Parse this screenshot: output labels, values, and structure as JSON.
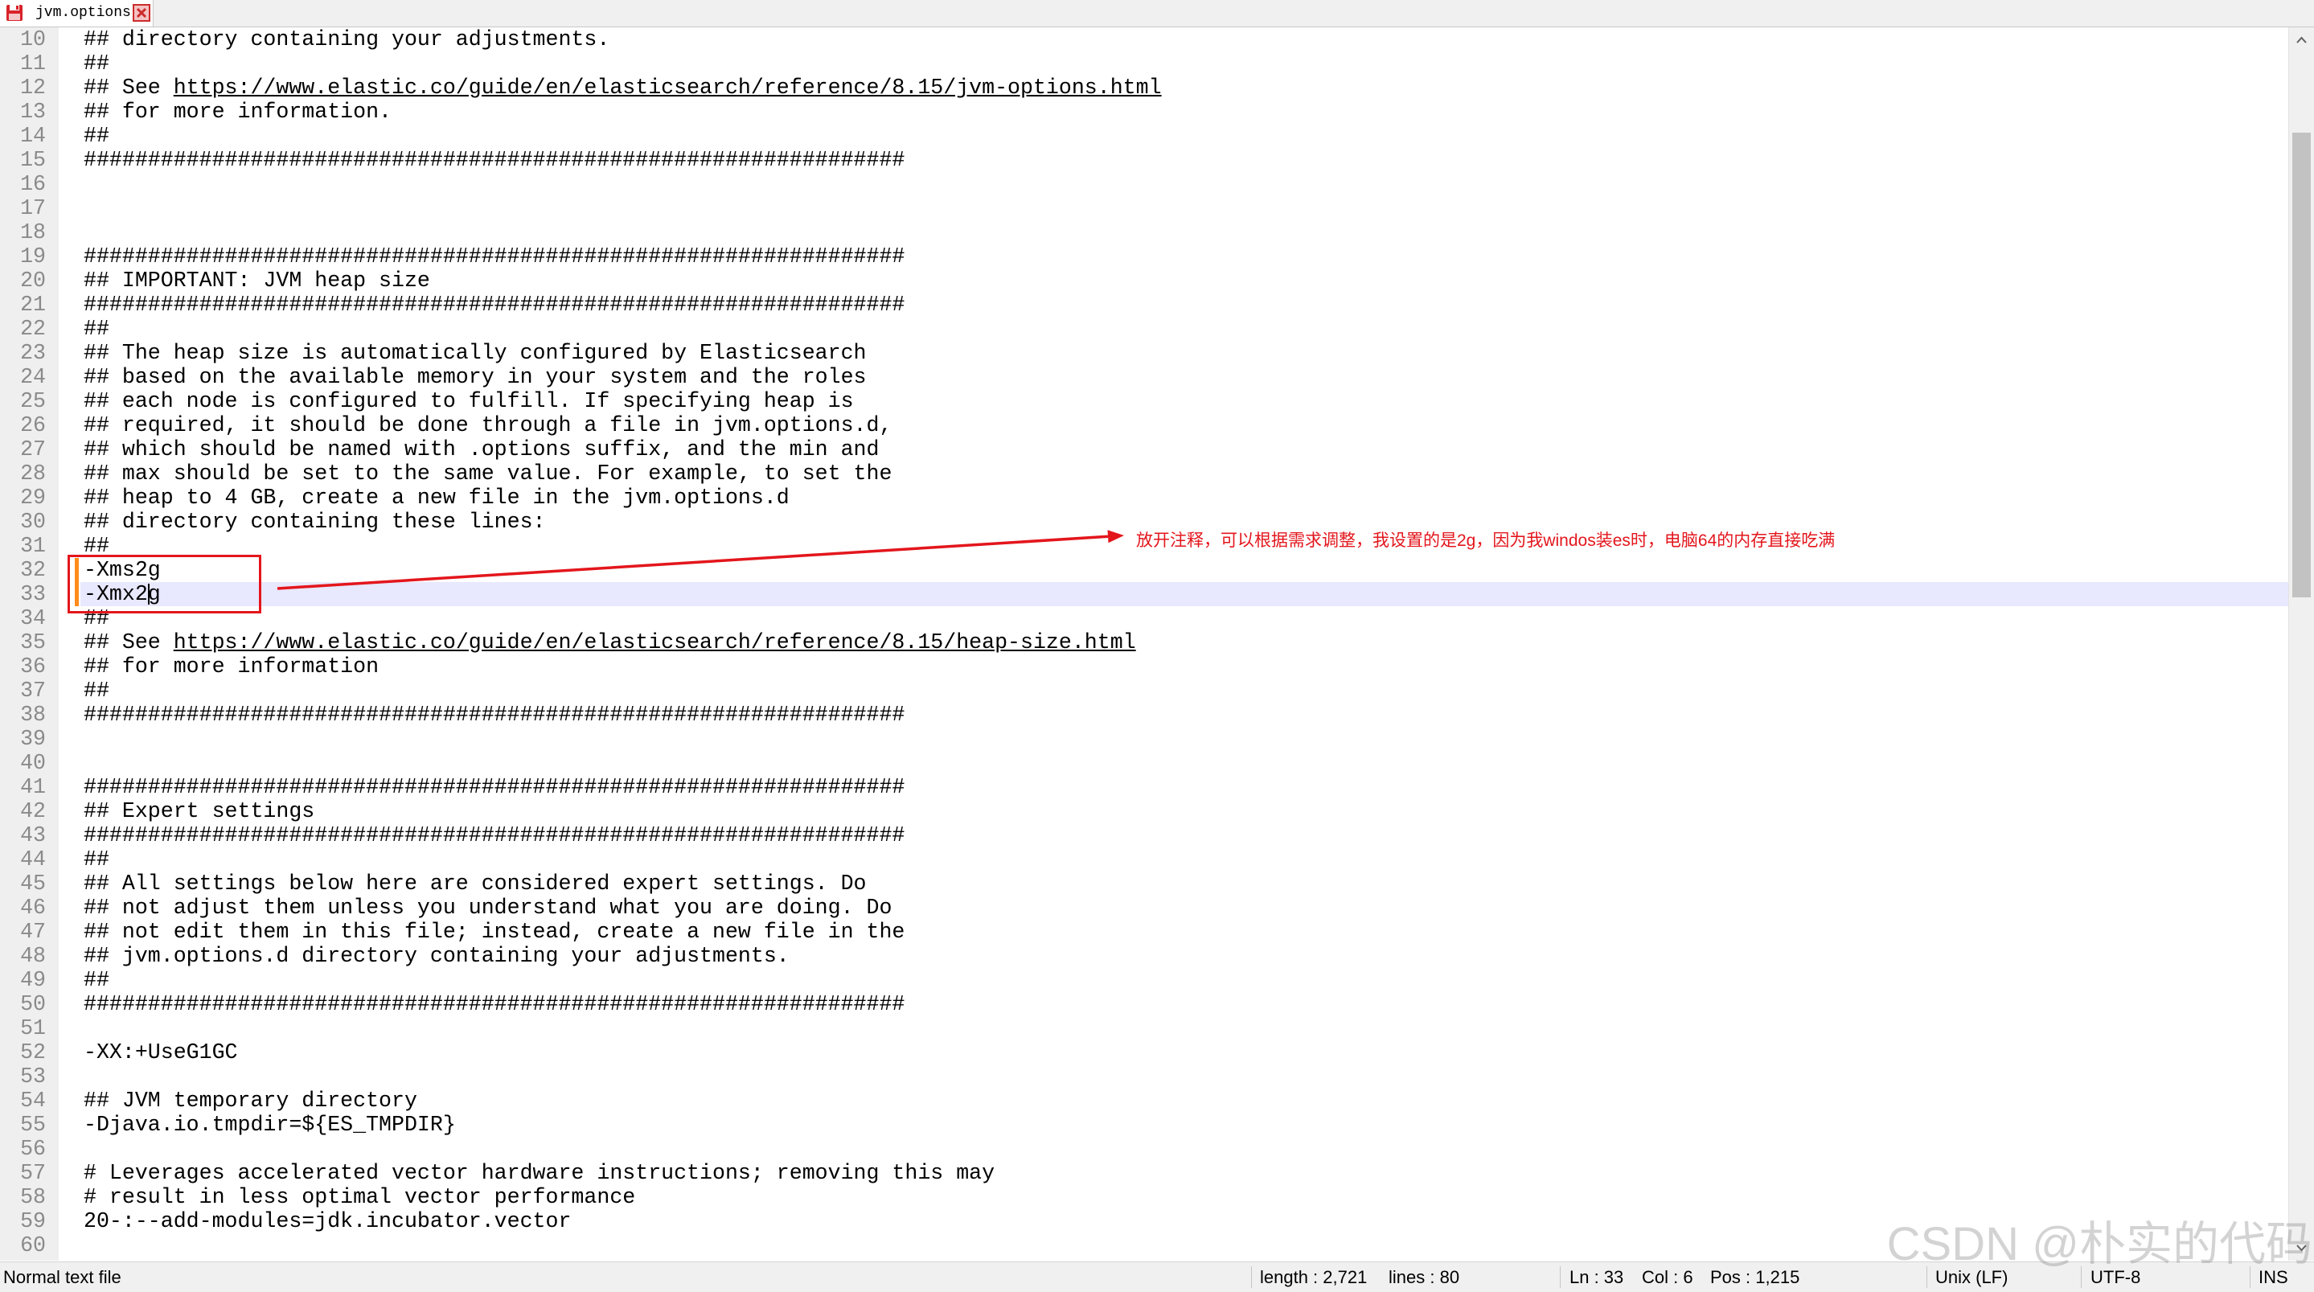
{
  "tab": {
    "title": "jvm.options",
    "icon": "unsaved-file-icon",
    "close_icon": "close-tab-icon"
  },
  "editor": {
    "current_line": 33,
    "caret_col": 6,
    "changed_lines": [
      32,
      33
    ],
    "lines": [
      {
        "n": "10",
        "text": "## directory containing your adjustments."
      },
      {
        "n": "11",
        "text": "##"
      },
      {
        "n": "12",
        "text": "## See ",
        "link": "https://www.elastic.co/guide/en/elasticsearch/reference/8.15/jvm-options.html"
      },
      {
        "n": "13",
        "text": "## for more information."
      },
      {
        "n": "14",
        "text": "##"
      },
      {
        "n": "15",
        "text": "################################################################"
      },
      {
        "n": "16",
        "text": ""
      },
      {
        "n": "17",
        "text": ""
      },
      {
        "n": "18",
        "text": ""
      },
      {
        "n": "19",
        "text": "################################################################"
      },
      {
        "n": "20",
        "text": "## IMPORTANT: JVM heap size"
      },
      {
        "n": "21",
        "text": "################################################################"
      },
      {
        "n": "22",
        "text": "##"
      },
      {
        "n": "23",
        "text": "## The heap size is automatically configured by Elasticsearch"
      },
      {
        "n": "24",
        "text": "## based on the available memory in your system and the roles"
      },
      {
        "n": "25",
        "text": "## each node is configured to fulfill. If specifying heap is"
      },
      {
        "n": "26",
        "text": "## required, it should be done through a file in jvm.options.d,"
      },
      {
        "n": "27",
        "text": "## which should be named with .options suffix, and the min and"
      },
      {
        "n": "28",
        "text": "## max should be set to the same value. For example, to set the"
      },
      {
        "n": "29",
        "text": "## heap to 4 GB, create a new file in the jvm.options.d"
      },
      {
        "n": "30",
        "text": "## directory containing these lines:"
      },
      {
        "n": "31",
        "text": "##"
      },
      {
        "n": "32",
        "text": "-Xms2g"
      },
      {
        "n": "33",
        "text": "-Xmx2g"
      },
      {
        "n": "34",
        "text": "##"
      },
      {
        "n": "35",
        "text": "## See ",
        "link": "https://www.elastic.co/guide/en/elasticsearch/reference/8.15/heap-size.html"
      },
      {
        "n": "36",
        "text": "## for more information"
      },
      {
        "n": "37",
        "text": "##"
      },
      {
        "n": "38",
        "text": "################################################################"
      },
      {
        "n": "39",
        "text": ""
      },
      {
        "n": "40",
        "text": ""
      },
      {
        "n": "41",
        "text": "################################################################"
      },
      {
        "n": "42",
        "text": "## Expert settings"
      },
      {
        "n": "43",
        "text": "################################################################"
      },
      {
        "n": "44",
        "text": "##"
      },
      {
        "n": "45",
        "text": "## All settings below here are considered expert settings. Do"
      },
      {
        "n": "46",
        "text": "## not adjust them unless you understand what you are doing. Do"
      },
      {
        "n": "47",
        "text": "## not edit them in this file; instead, create a new file in the"
      },
      {
        "n": "48",
        "text": "## jvm.options.d directory containing your adjustments."
      },
      {
        "n": "49",
        "text": "##"
      },
      {
        "n": "50",
        "text": "################################################################"
      },
      {
        "n": "51",
        "text": ""
      },
      {
        "n": "52",
        "text": "-XX:+UseG1GC"
      },
      {
        "n": "53",
        "text": ""
      },
      {
        "n": "54",
        "text": "## JVM temporary directory"
      },
      {
        "n": "55",
        "text": "-Djava.io.tmpdir=${ES_TMPDIR}"
      },
      {
        "n": "56",
        "text": ""
      },
      {
        "n": "57",
        "text": "# Leverages accelerated vector hardware instructions; removing this may"
      },
      {
        "n": "58",
        "text": "# result in less optimal vector performance"
      },
      {
        "n": "59",
        "text": "20-:--add-modules=jdk.incubator.vector"
      },
      {
        "n": "60",
        "text": ""
      }
    ]
  },
  "annotation": {
    "text": "放开注释，可以根据需求调整，我设置的是2g，因为我windos装es时，电脑64的内存直接吃满"
  },
  "watermark": "CSDN @朴实的代码",
  "status_bar": {
    "file_type": "Normal text file",
    "length": "length : 2,721",
    "lines": "lines : 80",
    "ln": "Ln : 33",
    "col": "Col : 6",
    "pos": "Pos : 1,215",
    "eol": "Unix (LF)",
    "encoding": "UTF-8",
    "mode": "INS"
  },
  "scrollbar": {
    "up_icon": "chevron-up-icon",
    "down_icon": "chevron-down-icon"
  },
  "colors": {
    "annotation": "#e3161c",
    "caret_line": "#e8e8ff",
    "changed_marker": "#ff8c1a"
  }
}
